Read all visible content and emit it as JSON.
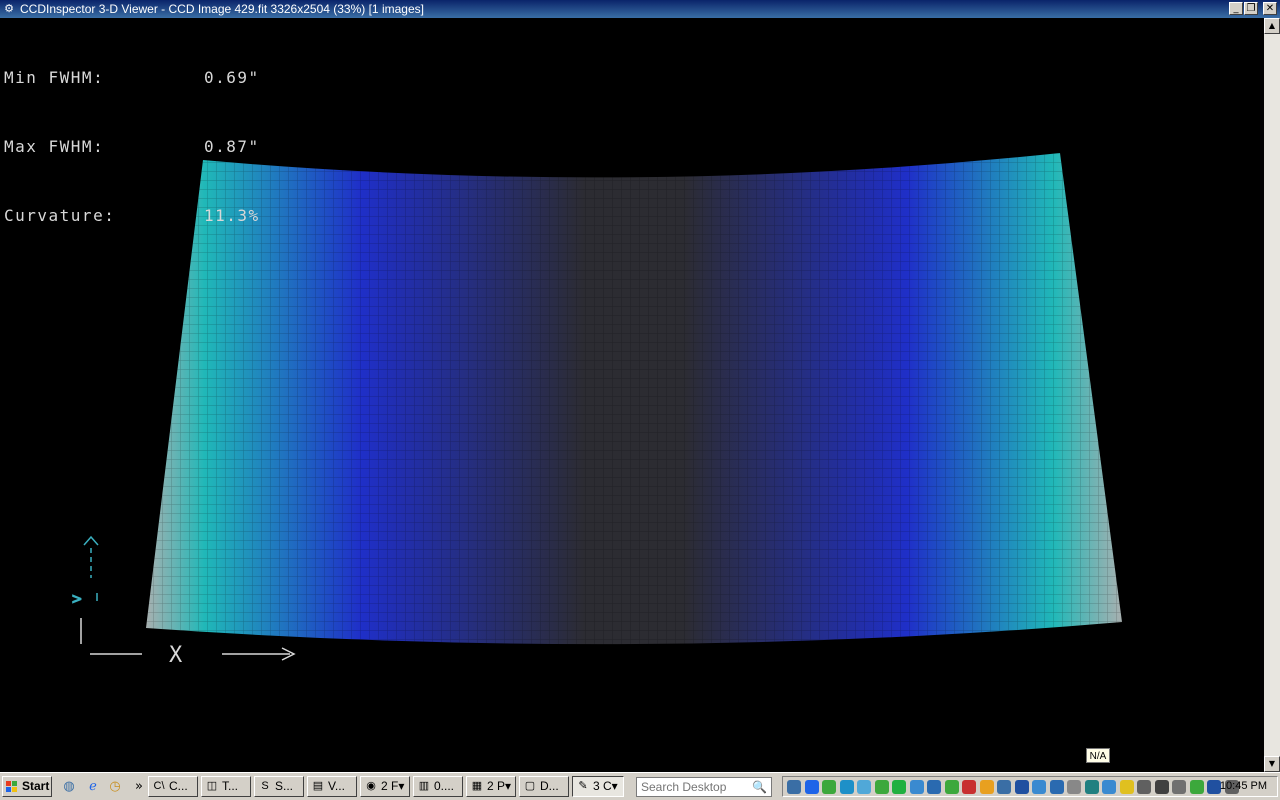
{
  "window": {
    "title": "CCDInspector 3-D Viewer - CCD Image 429.fit 3326x2504 (33%)  [1 images]",
    "minimize_icon": "_",
    "restore_icon": "❐",
    "close_icon": "✕"
  },
  "stats": [
    {
      "label": "Min FWHM:",
      "value": "0.69\""
    },
    {
      "label": "Max FWHM:",
      "value": "0.87\""
    },
    {
      "label": "Curvature:",
      "value": "11.3%"
    }
  ],
  "surface": {
    "color_center": "#2c2c32",
    "color_mid": "#1f2fc8",
    "color_edge": "#20b8b8",
    "color_corner": "#a8b0b0"
  },
  "axes": {
    "x_label": "X",
    "y_label": ">",
    "color": "#3ab0c0"
  },
  "na_label": "N/A",
  "taskbar": {
    "start_label": "Start",
    "quick_launch": [
      "network-icon",
      "ie-icon",
      "clock-icon",
      "more-icon"
    ],
    "more_glyph": "»",
    "tasks": [
      {
        "label": "C...",
        "icon": "C\\",
        "active": false
      },
      {
        "label": "T...",
        "icon": "◫",
        "active": false
      },
      {
        "label": "S...",
        "icon": "S",
        "active": false
      },
      {
        "label": "V...",
        "icon": "▤",
        "active": false
      },
      {
        "label": "2 F▾",
        "icon": "◉",
        "active": false
      },
      {
        "label": "0....",
        "icon": "▥",
        "active": false
      },
      {
        "label": "2 P▾",
        "icon": "▦",
        "active": false
      },
      {
        "label": "D...",
        "icon": "▢",
        "active": false
      },
      {
        "label": "3 C▾",
        "icon": "✎",
        "active": true
      }
    ],
    "search_placeholder": "Search Desktop",
    "search_icon": "🔍",
    "clock": "10:45 PM"
  }
}
